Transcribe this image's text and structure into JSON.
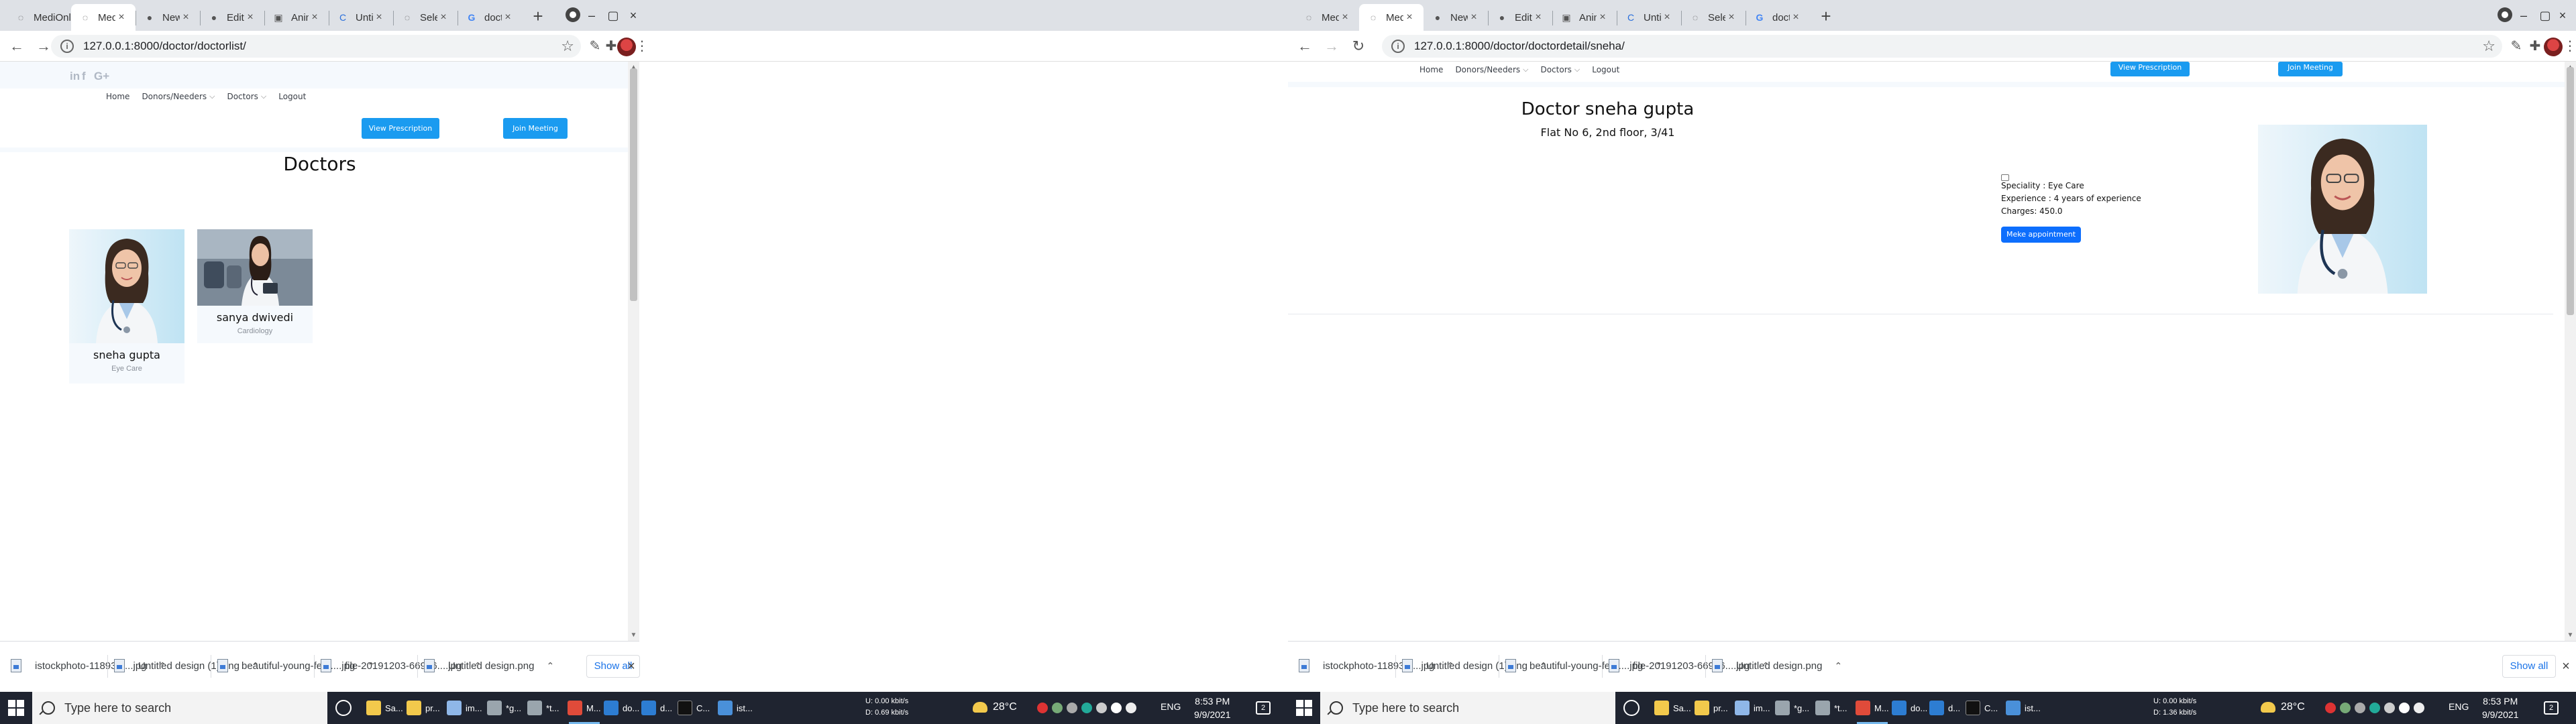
{
  "left": {
    "tabs": [
      {
        "label": "MediOnline"
      },
      {
        "label": "MediOnline"
      },
      {
        "label": "New Issue · varia"
      },
      {
        "label": "Editing medionlin"
      },
      {
        "label": "Animated GIF M"
      },
      {
        "label": "Untitled design"
      },
      {
        "label": "Select doctor to"
      },
      {
        "label": "doctor picture -"
      }
    ],
    "url": "127.0.0.1:8000/doctor/doctorlist/",
    "social": [
      "in",
      "f",
      "G+"
    ],
    "nav": {
      "home": "Home",
      "donors": "Donors/Needers",
      "doctors": "Doctors",
      "logout": "Logout"
    },
    "view_prescription": "View Prescription",
    "join_meeting": "Join Meeting",
    "page_title": "Doctors",
    "cards": [
      {
        "name": "sneha gupta",
        "specialty": "Eye Care"
      },
      {
        "name": "sanya dwivedi",
        "specialty": "Cardiology"
      }
    ],
    "downloads": [
      {
        "name": "istockphoto-118930....jpg"
      },
      {
        "name": "Untitled design (1).png"
      },
      {
        "name": "beautiful-young-fem....jpg"
      },
      {
        "name": "file-20191203-66986....jpg"
      },
      {
        "name": "Untitled design.png"
      }
    ],
    "show_all": "Show all"
  },
  "right": {
    "tabs": [
      {
        "label": "MediOnline"
      },
      {
        "label": "MediOnline"
      },
      {
        "label": "New Issue · varia"
      },
      {
        "label": "Editing medionlin"
      },
      {
        "label": "Animated GIF M"
      },
      {
        "label": "Untitled design"
      },
      {
        "label": "Select doctor to"
      },
      {
        "label": "doctor picture -"
      }
    ],
    "url": "127.0.0.1:8000/doctor/doctordetail/sneha/",
    "nav": {
      "home": "Home",
      "donors": "Donors/Needers",
      "doctors": "Doctors",
      "logout": "Logout"
    },
    "view_prescription": "View Prescription",
    "join_meeting": "Join Meeting",
    "doctor_title": "Doctor sneha gupta",
    "address": "Flat No 6, 2nd floor, 3/41",
    "speciality": "Speciality : Eye Care",
    "experience": "Experience : 4 years of experience",
    "charges": "Charges: 450.0",
    "appointment_button": "Meke appointment",
    "downloads": [
      {
        "name": "istockphoto-118930....jpg"
      },
      {
        "name": "Untitled design (1).png"
      },
      {
        "name": "beautiful-young-fem....jpg"
      },
      {
        "name": "file-20191203-66986....jpg"
      },
      {
        "name": "Untitled design.png"
      }
    ],
    "show_all": "Show all"
  },
  "taskbar_left": {
    "search_placeholder": "Type here to search",
    "apps": [
      "Sa...",
      "pr...",
      "im...",
      "*g...",
      "*t...",
      "M...",
      "do...",
      "d...",
      "C...",
      "ist..."
    ],
    "net_up": "0.00 kbit/s",
    "net_down": "0.69 kbit/s",
    "net_u_label": "U:",
    "net_d_label": "D:",
    "weather": "28°C",
    "lang": "ENG",
    "time": "8:53 PM",
    "date": "9/9/2021",
    "notif": "2"
  },
  "taskbar_right": {
    "search_placeholder": "Type here to search",
    "apps": [
      "Sa...",
      "pr...",
      "im...",
      "*g...",
      "*t...",
      "M...",
      "do...",
      "d...",
      "C...",
      "ist..."
    ],
    "net_up": "0.00 kbit/s",
    "net_down": "1.36 kbit/s",
    "net_u_label": "U:",
    "net_d_label": "D:",
    "weather": "28°C",
    "lang": "ENG",
    "time": "8:53 PM",
    "date": "9/9/2021",
    "notif": "2"
  },
  "colors": {
    "nav_button": "#1a9bf0",
    "primary_button": "#0d6efd",
    "header_strip": "#f5f9fd",
    "taskbar": "#1f2430"
  }
}
